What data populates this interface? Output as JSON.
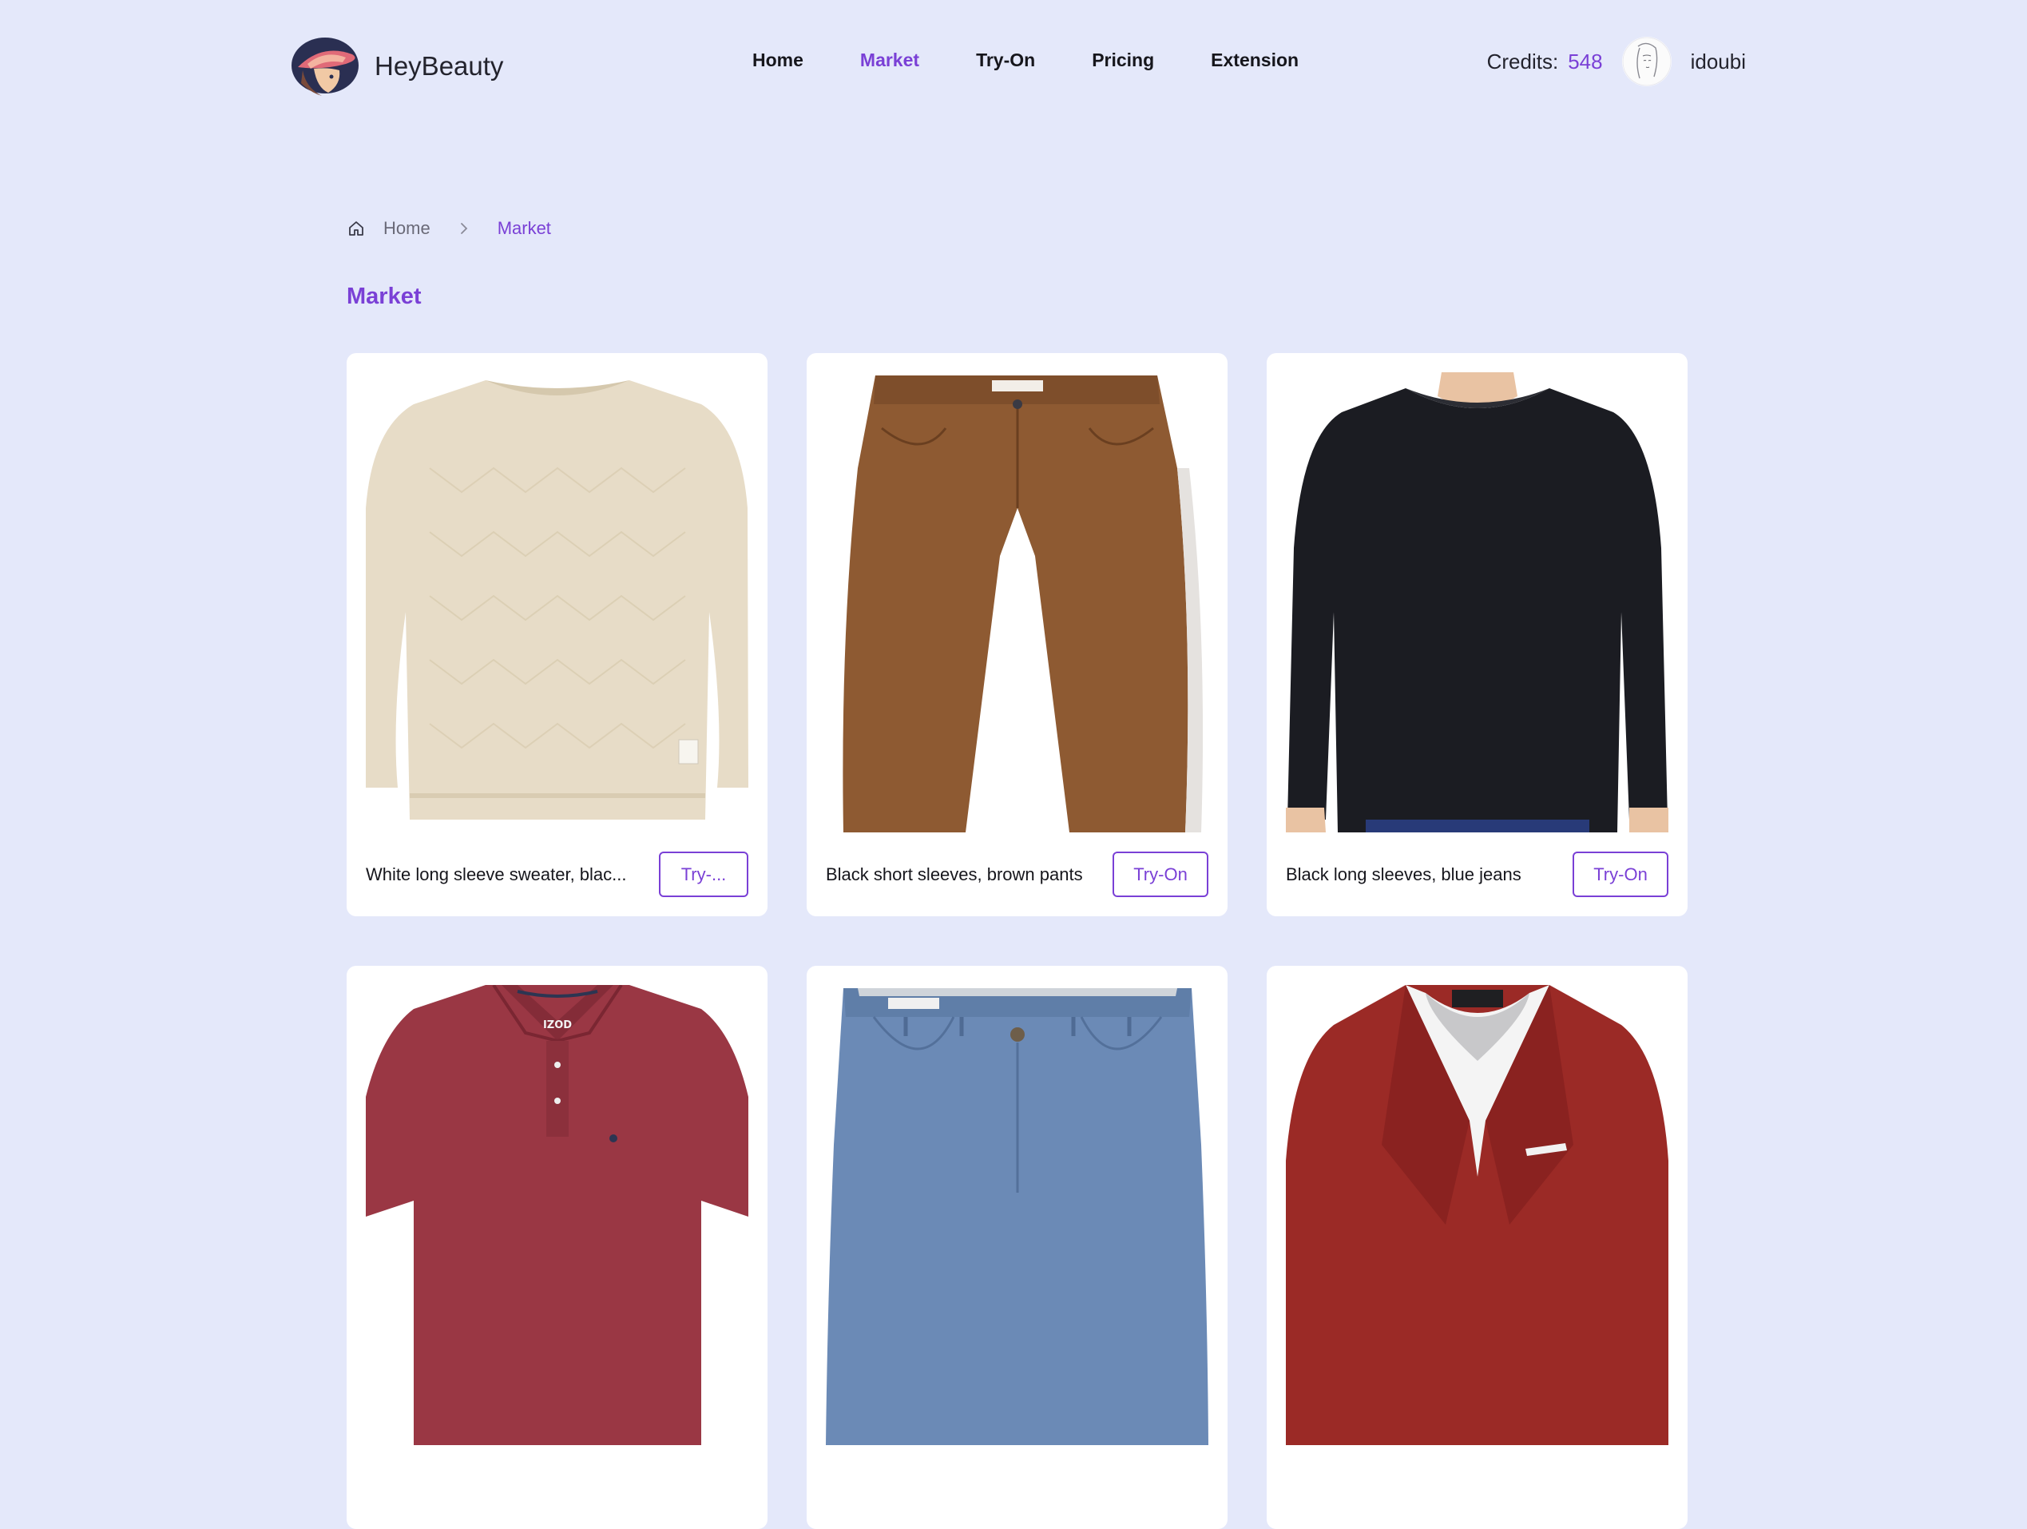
{
  "app": {
    "name": "HeyBeauty"
  },
  "nav": [
    {
      "label": "Home",
      "active": false
    },
    {
      "label": "Market",
      "active": true
    },
    {
      "label": "Try-On",
      "active": false
    },
    {
      "label": "Pricing",
      "active": false
    },
    {
      "label": "Extension",
      "active": false
    }
  ],
  "account": {
    "credits_label": "Credits:",
    "credits_value": "548",
    "username": "idoubi",
    "avatar_icon": "user-sketch-avatar"
  },
  "breadcrumb": {
    "home_icon": "home-icon",
    "home": "Home",
    "separator_icon": "chevron-right-icon",
    "current": "Market"
  },
  "page": {
    "title": "Market"
  },
  "colors": {
    "accent": "#7a40d6",
    "background": "#e4e8fa",
    "card": "#ffffff"
  },
  "products": [
    {
      "caption": "White long sleeve sweater, blac...",
      "button": "Try-...",
      "garment": "beige-sweater"
    },
    {
      "caption": "Black short sleeves, brown pants",
      "button": "Try-On",
      "garment": "brown-pants"
    },
    {
      "caption": "Black long sleeves, blue jeans",
      "button": "Try-On",
      "garment": "black-long-sleeve"
    },
    {
      "caption": "",
      "button": "",
      "garment": "red-polo"
    },
    {
      "caption": "",
      "button": "",
      "garment": "blue-chinos"
    },
    {
      "caption": "",
      "button": "",
      "garment": "red-blazer"
    }
  ],
  "brand_marks": {
    "polo_logo": "IZOD"
  }
}
